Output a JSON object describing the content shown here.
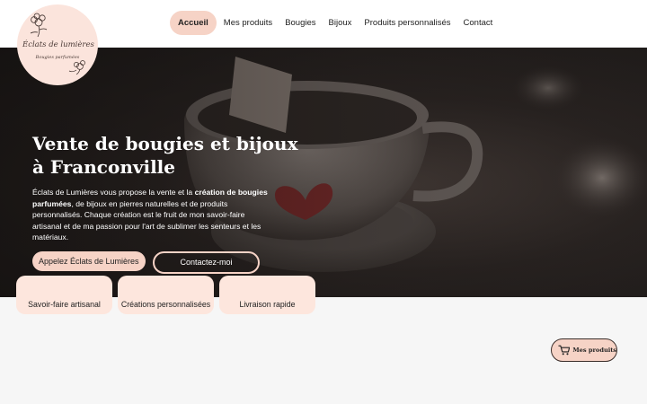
{
  "logo": {
    "name": "Éclats de lumières",
    "tagline": "Bougies parfumées"
  },
  "nav": {
    "items": [
      {
        "label": "Accueil",
        "active": true
      },
      {
        "label": "Mes produits",
        "active": false
      },
      {
        "label": "Bougies",
        "active": false
      },
      {
        "label": "Bijoux",
        "active": false
      },
      {
        "label": "Produits personnalisés",
        "active": false
      },
      {
        "label": "Contact",
        "active": false
      }
    ]
  },
  "hero": {
    "title": "Vente de bougies et bijoux à Franconville",
    "text_1": "Éclats de Lumières vous propose la vente et la ",
    "text_bold_1": "création de bougies parfumées",
    "text_2": ", de bijoux en pierres naturelles et de produits personnalisés. Chaque création est le fruit de mon savoir-faire artisanal et de ma passion pour l'art de sublimer les senteurs et les matériaux.",
    "cta_call": "Appelez Éclats de Lumières",
    "cta_contact": "Contactez-moi"
  },
  "features": [
    {
      "label": "Savoir-faire artisanal"
    },
    {
      "label": "Créations personnalisées"
    },
    {
      "label": "Livraison rapide"
    }
  ],
  "cart": {
    "label": "Mes produits",
    "icon": "cart-icon"
  },
  "colors": {
    "accent": "#f6d3c6",
    "card_bg": "#fde6dd",
    "header_bg": "#ffffff",
    "page_bg": "#f6f6f6"
  }
}
